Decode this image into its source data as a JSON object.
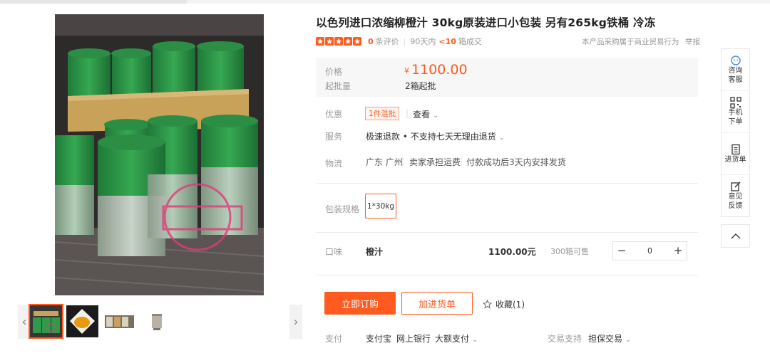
{
  "product": {
    "title": "以色列进口浓缩柳橙汁 30kg原装进口小包装 另有265kg铁桶 冷冻",
    "reviews_count": "0",
    "reviews_label": "条评价",
    "period_label": "90天内",
    "deals_value": "<10",
    "deals_label": "箱成交",
    "notice": "本产品采购属于商业贸易行为",
    "report": "举报"
  },
  "price": {
    "price_label": "价格",
    "currency": "¥",
    "price_value": "1100.00",
    "moq_label": "起批量",
    "moq_value": "2箱起批"
  },
  "promo": {
    "label": "优惠",
    "tag": "1件混批",
    "view": "查看"
  },
  "service": {
    "label": "服务",
    "value": "极速退款 • 不支持七天无理由退货"
  },
  "logistics": {
    "label": "物流",
    "location": "广东 广州",
    "freight": "卖家承担运费",
    "shipping": "付款成功后3天内安排发货"
  },
  "spec": {
    "label": "包装规格",
    "option": "1*30kg"
  },
  "flavor": {
    "label": "口味",
    "name": "橙汁",
    "price": "1100.00元",
    "stock": "300箱可售",
    "quantity": "0",
    "minus": "−",
    "plus": "+"
  },
  "actions": {
    "buy": "立即订购",
    "cart": "加进货单",
    "favorite": "收藏(1)"
  },
  "payment": {
    "label": "支付",
    "methods": [
      "支付宝",
      "网上银行",
      "大额支付"
    ],
    "trade_label": "交易支持",
    "trade_value": "担保交易"
  },
  "sidebar": {
    "items": [
      {
        "icon": "service-icon",
        "label1": "咨询",
        "label2": "客服"
      },
      {
        "icon": "qrcode-icon",
        "label1": "手机",
        "label2": "下单"
      },
      {
        "icon": "list-icon",
        "label1": "进货单",
        "label2": ""
      },
      {
        "icon": "edit-icon",
        "label1": "意见",
        "label2": "反馈"
      }
    ],
    "top_icon": "chevron-up-icon"
  },
  "colors": {
    "accent": "#ff5a1f",
    "barrel_green": "#2f9a4a",
    "muted": "#999999"
  }
}
